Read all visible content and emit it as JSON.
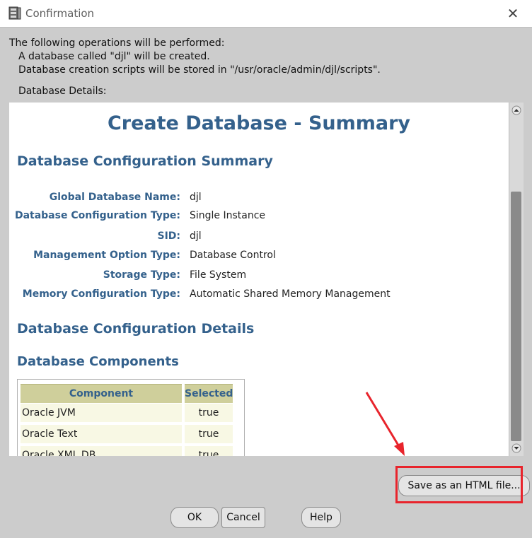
{
  "window": {
    "title": "Confirmation"
  },
  "operations": {
    "heading": "The following operations will be performed:",
    "items": [
      "A database called \"djl\" will be created.",
      "Database creation scripts will be stored in \"/usr/oracle/admin/djl/scripts\"."
    ]
  },
  "details_label": "Database Details:",
  "summary": {
    "title": "Create Database - Summary",
    "config_summary_heading": "Database Configuration Summary",
    "fields": [
      {
        "label": "Global Database Name:",
        "value": "djl"
      },
      {
        "label": "Database Configuration Type:",
        "value": "Single Instance"
      },
      {
        "label": "SID:",
        "value": "djl"
      },
      {
        "label": "Management Option Type:",
        "value": "Database Control"
      },
      {
        "label": "Storage Type:",
        "value": "File System"
      },
      {
        "label": "Memory Configuration Type:",
        "value": "Automatic Shared Memory Management"
      }
    ],
    "config_details_heading": "Database Configuration Details",
    "components_heading": "Database Components",
    "components_table": {
      "headers": [
        "Component",
        "Selected"
      ],
      "rows": [
        [
          "Oracle JVM",
          "true"
        ],
        [
          "Oracle Text",
          "true"
        ],
        [
          "Oracle XML DB",
          "true"
        ]
      ]
    }
  },
  "buttons": {
    "save_html": "Save as an HTML file...",
    "ok": "OK",
    "cancel": "Cancel",
    "help": "Help"
  },
  "colors": {
    "heading": "#34618c",
    "annotation": "#e8242c",
    "table_header": "#cfcf9b",
    "table_cell": "#f8f8e4"
  }
}
